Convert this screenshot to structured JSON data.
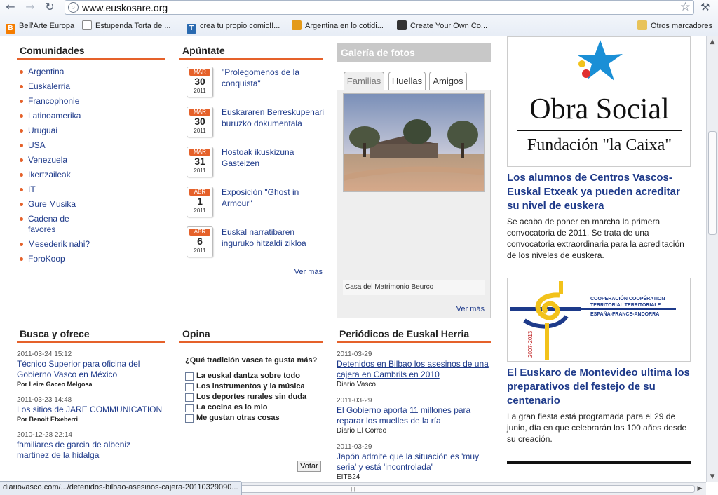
{
  "browser": {
    "url": "www.euskosare.org",
    "bookmarks": [
      {
        "label": "Bell'Arte Europa",
        "icon": "blogger-icon"
      },
      {
        "label": "Estupenda Torta de ...",
        "icon": "page-icon"
      },
      {
        "label": "crea tu propio comic!!...",
        "icon": "t-icon"
      },
      {
        "label": "Argentina en lo cotidi...",
        "icon": "flag-icon"
      },
      {
        "label": "Create Your Own Co...",
        "icon": "mask-icon"
      }
    ],
    "other_bookmarks": "Otros marcadores",
    "status_url": "diariovasco.com/.../detenidos-bilbao-asesinos-cajera-20110329090..."
  },
  "comunidades": {
    "title": "Comunidades",
    "items": [
      "Argentina",
      "Euskalerria",
      "Francophonie",
      "Latinoamerika",
      "Uruguai",
      "USA",
      "Venezuela",
      "Ikertzaileak",
      "IT",
      "Gure Musika",
      "Cadena de favores",
      "Mesederik nahi?",
      "ForoKoop"
    ]
  },
  "apuntate": {
    "title": "Apúntate",
    "events": [
      {
        "month": "MAR",
        "day": "30",
        "year": "2011",
        "title": "\"Prolegomenos de la conquista\""
      },
      {
        "month": "MAR",
        "day": "30",
        "year": "2011",
        "title": "Euskararen Berreskupenari buruzko dokumentala"
      },
      {
        "month": "MAR",
        "day": "31",
        "year": "2011",
        "title": "Hostoak ikuskizuna Gasteizen"
      },
      {
        "month": "ABR",
        "day": "1",
        "year": "2011",
        "title": "Exposición \"Ghost in Armour\""
      },
      {
        "month": "ABR",
        "day": "6",
        "year": "2011",
        "title": "Euskal narratibaren inguruko hitzaldi zikloa"
      }
    ],
    "more": "Ver más"
  },
  "galeria": {
    "title": "Galería de fotos",
    "tabs": [
      "Familias",
      "Huellas",
      "Amigos"
    ],
    "caption": "Casa del Matrimonio Beurco",
    "more": "Ver más"
  },
  "busca": {
    "title": "Busca y ofrece",
    "items": [
      {
        "date": "2011-03-24 15:12",
        "title": "Técnico Superior para oficina del Gobierno Vasco en México",
        "author": "Por Leire Gaceo Melgosa"
      },
      {
        "date": "2011-03-23 14:48",
        "title": "Los sitios de JARE COMMUNICATION",
        "author": "Por Benoit Etxeberri"
      },
      {
        "date": "2010-12-28 22:14",
        "title": "familiares de garcia de albeniz martinez de la hidalga",
        "author": ""
      }
    ]
  },
  "opina": {
    "title": "Opina",
    "question": "¿Qué tradición vasca te gusta más?",
    "options": [
      "La euskal dantza sobre todo",
      "Los instrumentos y la música",
      "Los deportes rurales sin duda",
      "La cocina es lo mio",
      "Me gustan otras cosas"
    ],
    "vote_label": "Votar"
  },
  "periodicos": {
    "title": "Periódicos de Euskal Herria",
    "items": [
      {
        "date": "2011-03-29",
        "title": "Detenidos en Bilbao los asesinos de una cajera en Cambrils en 2010",
        "source": "Diario Vasco"
      },
      {
        "date": "2011-03-29",
        "title": "El Gobierno aporta 11 millones para reparar los muelles de la ría",
        "source": "Diario El Correo"
      },
      {
        "date": "2011-03-29",
        "title": "Japón admite que la situación es 'muy seria' y está 'incontrolada'",
        "source": "EITB24"
      }
    ]
  },
  "sidebar": {
    "logo_line1": "Obra Social",
    "logo_line2": "Fundación \"la Caixa\"",
    "story1_title": "Los alumnos de Centros Vascos-Euskal Etxeak ya pueden acreditar su nivel de euskera",
    "story1_text": "Se acaba de poner en marcha la primera convocatoria de 2011. Se trata de una convocatoria extraordinaria para la acreditación de los niveles de euskera.",
    "coop_line1": "COOPERACIÓN COOPÉRATION",
    "coop_line2": "TERRITORIAL TERRITORIALE",
    "coop_line3": "ESPAÑA-FRANCE-ANDORRA",
    "coop_years": "2007-2013",
    "story2_title": "El Euskaro de Montevideo ultima los preparativos del festejo de su centenario",
    "story2_text": "La gran fiesta está programada para el 29 de junio, día en que celebrarán los 100 años desde su creación."
  },
  "colors": {
    "accent": "#e5612a",
    "link": "#1e3a8a"
  }
}
